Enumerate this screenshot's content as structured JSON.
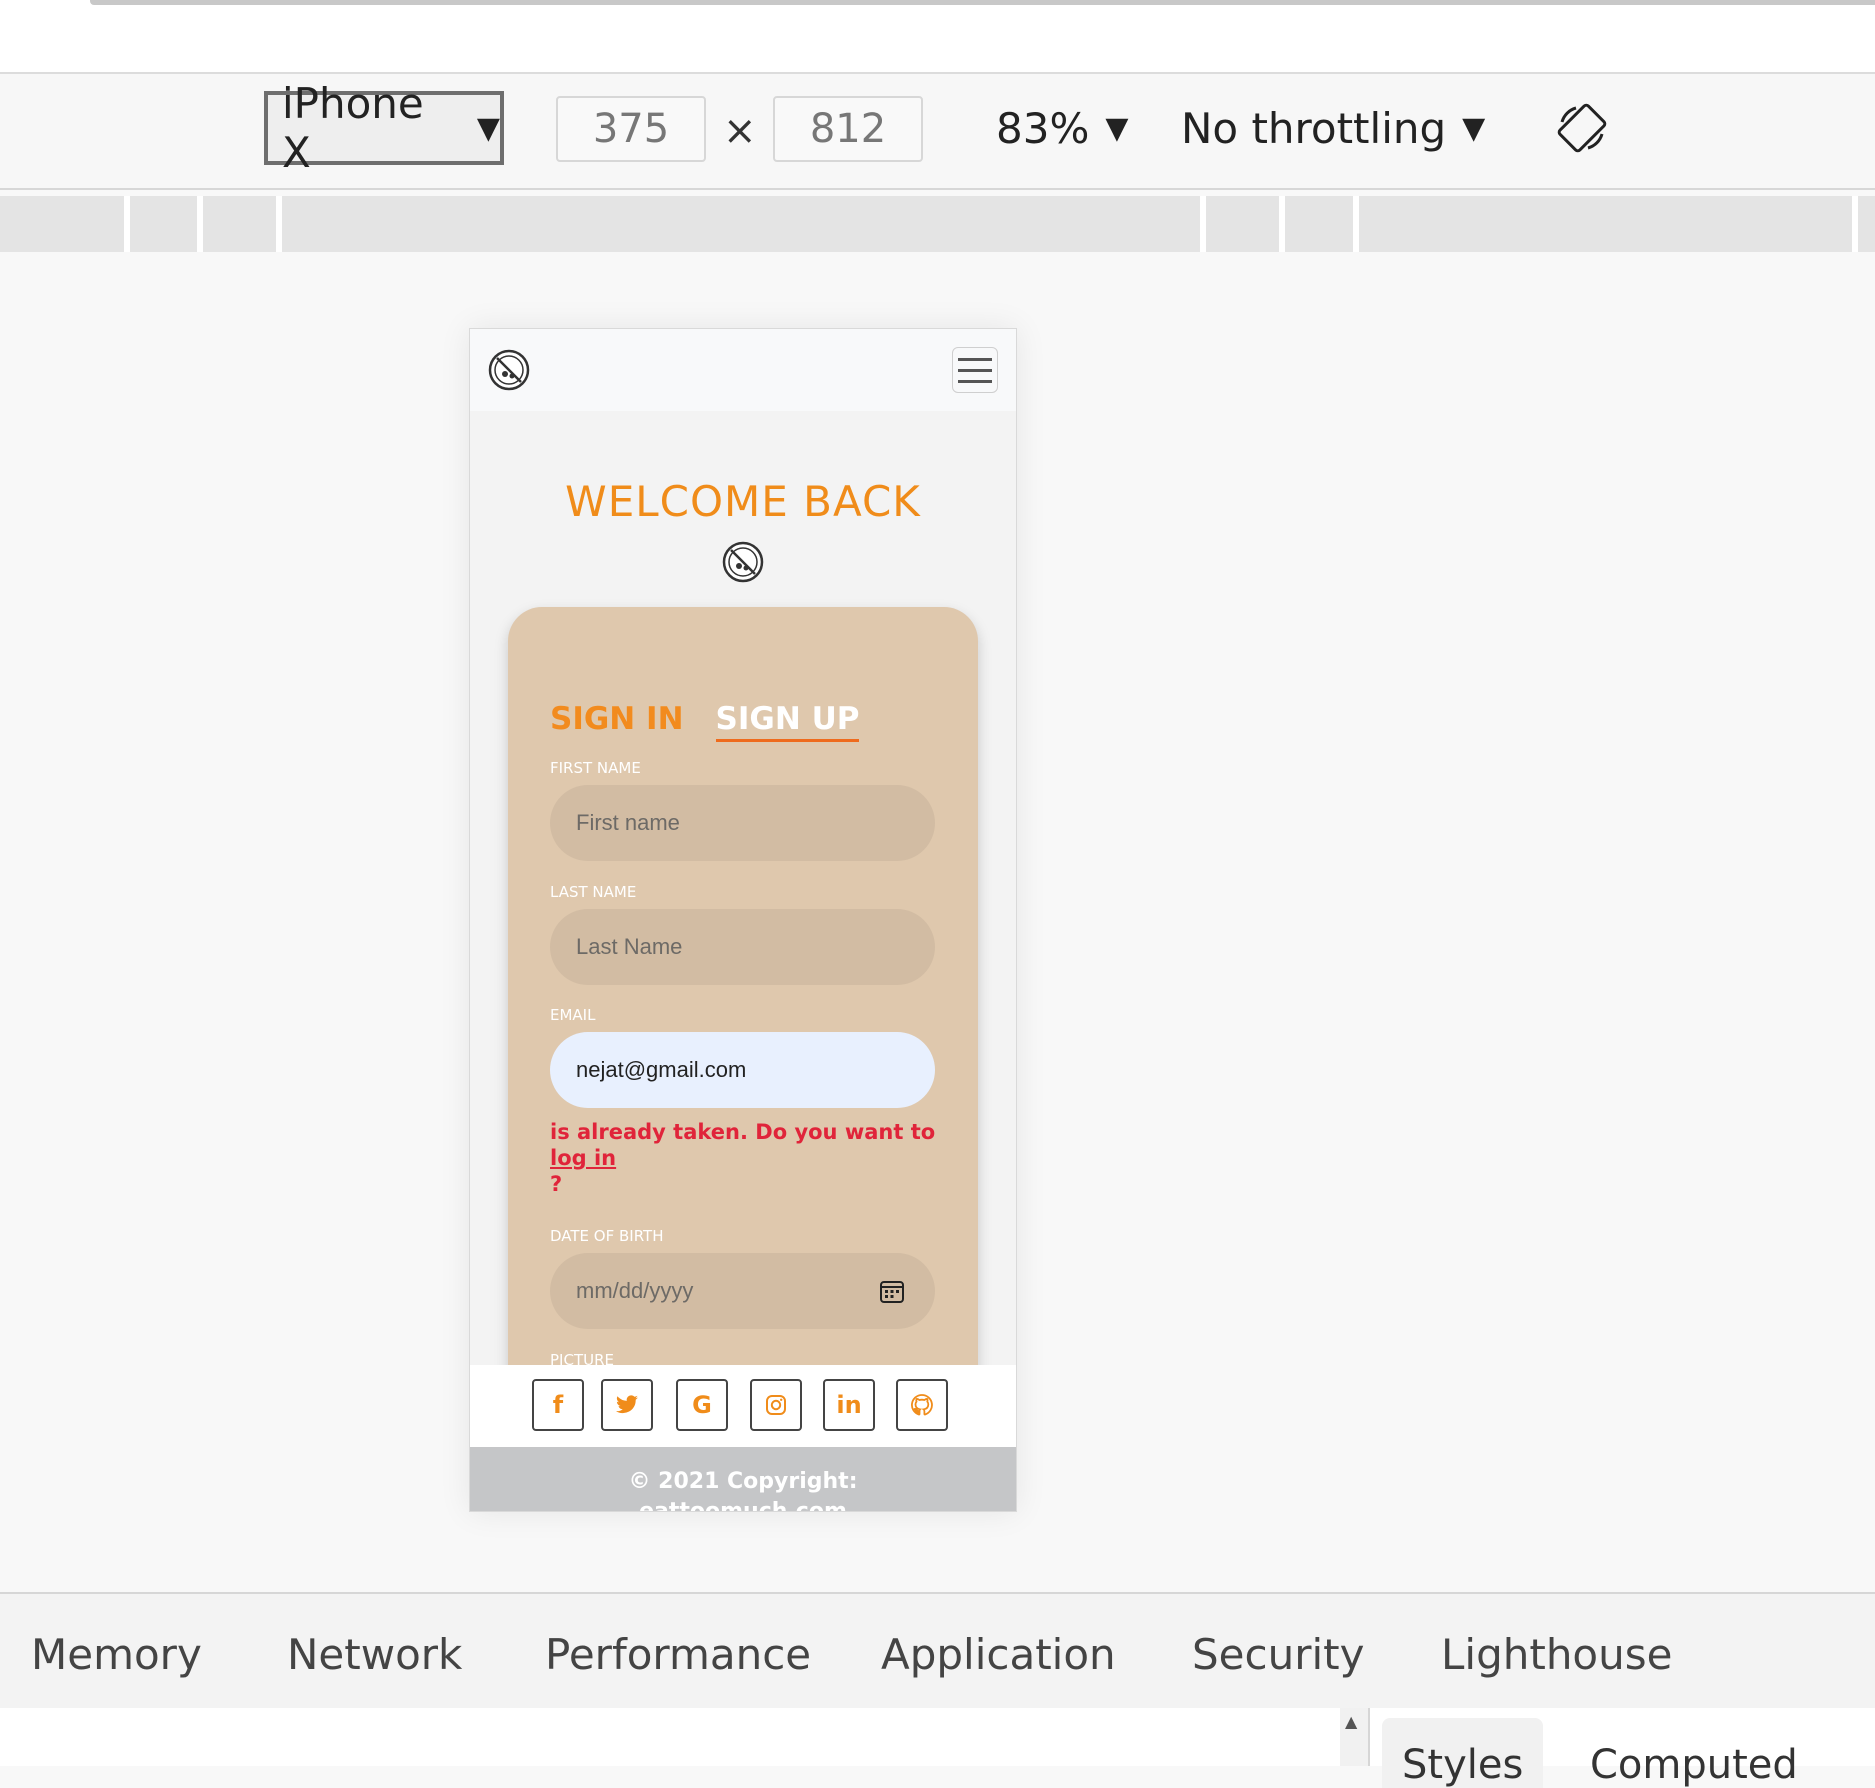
{
  "toolbar": {
    "device": "iPhone X",
    "width": "375",
    "height": "812",
    "dimension_separator": "×",
    "zoom": "83%",
    "throttling": "No throttling"
  },
  "page": {
    "welcome_title": "WELCOME BACK",
    "tabs": {
      "sign_in": "SIGN IN",
      "sign_up": "SIGN UP"
    },
    "fields": {
      "first_name": {
        "label": "FIRST NAME",
        "placeholder": "First name"
      },
      "last_name": {
        "label": "LAST NAME",
        "placeholder": "Last Name"
      },
      "email": {
        "label": "EMAIL",
        "value": "nejat@gmail.com"
      },
      "date_of_birth": {
        "label": "DATE OF BIRTH",
        "placeholder": "mm/dd/yyyy"
      },
      "picture": {
        "label": "PICTURE"
      }
    },
    "error": {
      "message": "is already taken. Do you want to",
      "link": "log in",
      "suffix": "?"
    },
    "social": {
      "facebook": "f",
      "google": "G",
      "linkedin": "in"
    },
    "footer": {
      "copyright": "© 2021 Copyright:",
      "site": "eattoomuch.com"
    }
  },
  "devtools": {
    "tabs": [
      "Memory",
      "Network",
      "Performance",
      "Application",
      "Security",
      "Lighthouse"
    ],
    "sub_tabs": [
      "Styles",
      "Computed"
    ]
  }
}
